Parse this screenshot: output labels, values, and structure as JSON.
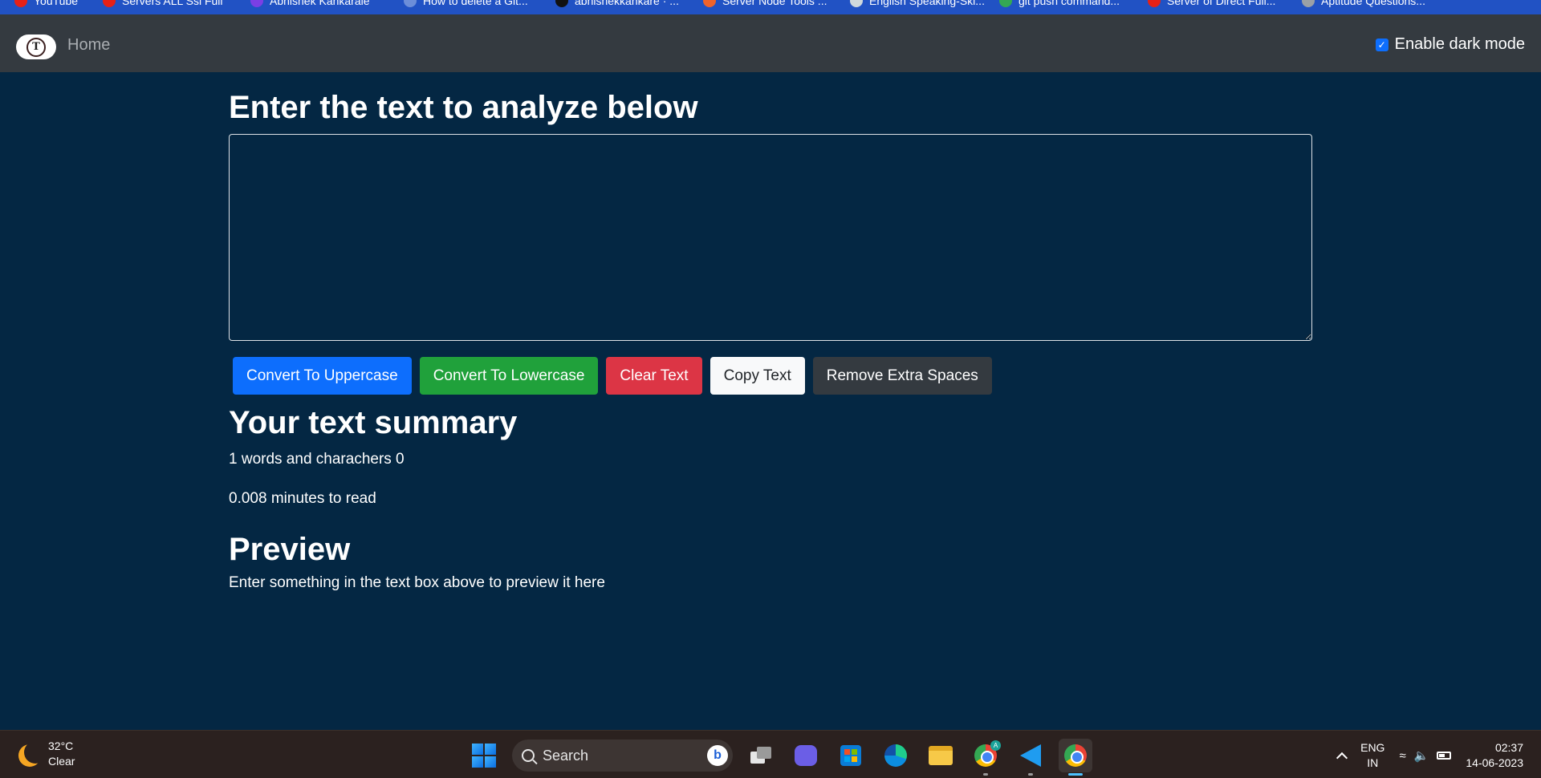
{
  "bookmarks": [
    "YouTube",
    "Servers ALL Ssl Full",
    "Abhishek Kankarale",
    "How to delete a Git...",
    "abhishekkankare · ...",
    "Server Node Tools ...",
    "English Speaking-Ski...",
    "git push command...",
    "Server of Direct Full...",
    "Aptitude Questions..."
  ],
  "navbar": {
    "logo_letter": "T",
    "home_label": "Home",
    "dark_mode_label": "Enable dark mode",
    "dark_mode_checked": true
  },
  "main": {
    "title": "Enter the text to analyze below",
    "textarea_value": "",
    "buttons": {
      "uppercase": "Convert To Uppercase",
      "lowercase": "Convert To Lowercase",
      "clear": "Clear Text",
      "copy": "Copy Text",
      "remove_spaces": "Remove Extra Spaces"
    },
    "summary_heading": "Your text summary",
    "summary_words": "1 words and charachers 0",
    "summary_read_time": "0.008 minutes to read",
    "preview_heading": "Preview",
    "preview_text": "Enter something in the text box above to preview it here"
  },
  "taskbar": {
    "weather_temp": "32°C",
    "weather_desc": "Clear",
    "search_label": "Search",
    "bing_letter": "b",
    "chrome_badge": "A",
    "lang_line1": "ENG",
    "lang_line2": "IN",
    "time": "02:37",
    "date": "14-06-2023"
  },
  "colors": {
    "page_bg": "#042743",
    "navbar_bg": "#343a40",
    "primary": "#0d6efd",
    "success": "#20a13b",
    "danger": "#dc3545",
    "light": "#f8f9fa",
    "dark": "#343a40"
  }
}
